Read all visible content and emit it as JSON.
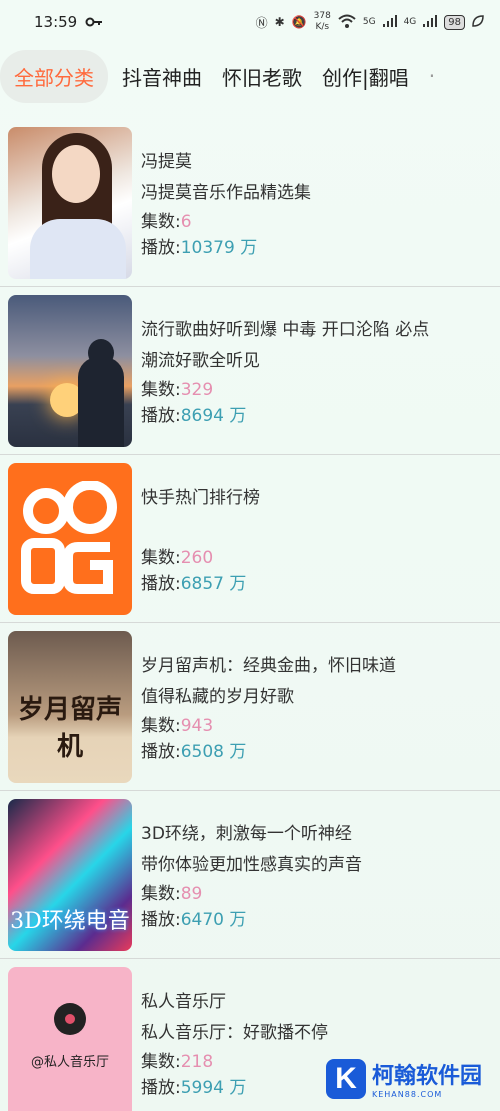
{
  "status_bar": {
    "time": "13:59",
    "speed_value": "378",
    "speed_unit": "K/s",
    "signal_1": "5G",
    "signal_2": "4G",
    "battery": "98"
  },
  "tabs": [
    {
      "label": "全部分类",
      "active": true
    },
    {
      "label": "抖音神曲",
      "active": false
    },
    {
      "label": "怀旧老歌",
      "active": false
    },
    {
      "label": "创作|翻唱",
      "active": false
    }
  ],
  "playlists": [
    {
      "title": "冯提莫",
      "subtitle": "冯提莫音乐作品精选集",
      "count_label": "集数:",
      "count": "6",
      "plays_label": "播放:",
      "plays": "10379 万"
    },
    {
      "title": "流行歌曲好听到爆 中毒 开口沦陷 必点",
      "subtitle": "潮流好歌全听见",
      "count_label": "集数:",
      "count": "329",
      "plays_label": "播放:",
      "plays": "8694 万"
    },
    {
      "title": "快手热门排行榜",
      "subtitle": "",
      "count_label": "集数:",
      "count": "260",
      "plays_label": "播放:",
      "plays": "6857 万"
    },
    {
      "title": "岁月留声机：经典金曲，怀旧味道",
      "subtitle": "值得私藏的岁月好歌",
      "count_label": "集数:",
      "count": "943",
      "plays_label": "播放:",
      "plays": "6508 万",
      "cover_text": "岁月留声机"
    },
    {
      "title": "3D环绕，刺激每一个听神经",
      "subtitle": "带你体验更加性感真实的声音",
      "count_label": "集数:",
      "count": "89",
      "plays_label": "播放:",
      "plays": "6470 万",
      "cover_text": "3D环绕电音"
    },
    {
      "title": "私人音乐厅",
      "subtitle": "私人音乐厅：好歌播不停",
      "count_label": "集数:",
      "count": "218",
      "plays_label": "播放:",
      "plays": "5994 万",
      "cover_text": "@私人音乐厅"
    }
  ],
  "watermark": {
    "logo_letter": "K",
    "name": "柯翰软件园",
    "url": "KEHAN88.COM"
  },
  "colors": {
    "active_tab": "#ff6a3d",
    "count": "#e58fb0",
    "plays": "#3d9fb2"
  }
}
